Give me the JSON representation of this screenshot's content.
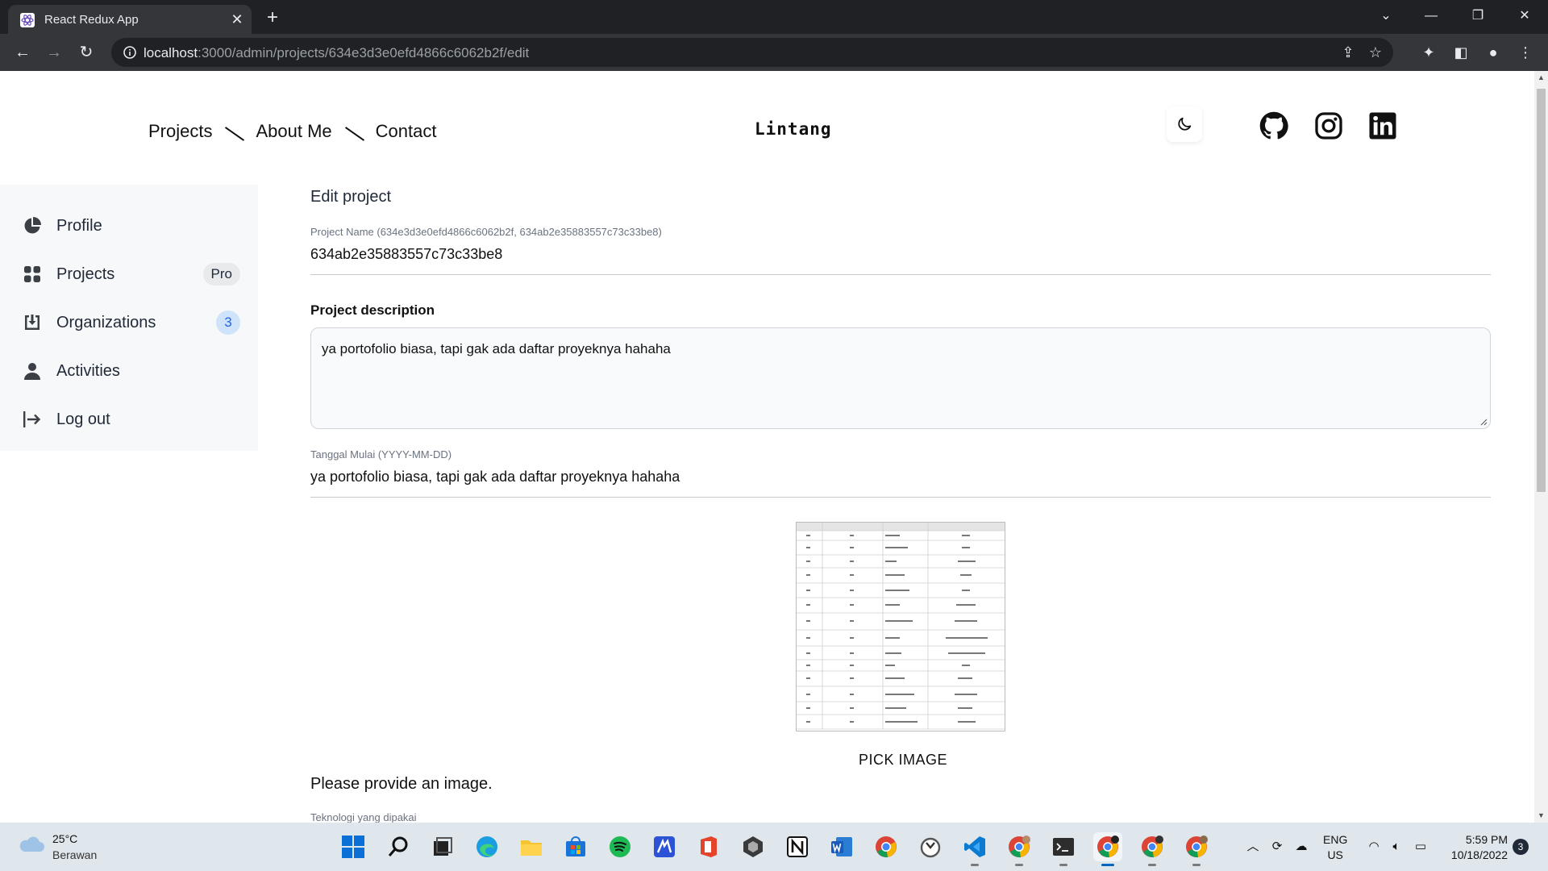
{
  "browser": {
    "tab_title": "React Redux App",
    "url_host": "localhost",
    "url_rest": ":3000/admin/projects/634e3d3e0efd4866c6062b2f/edit"
  },
  "header": {
    "nav": [
      "Projects",
      "About Me",
      "Contact"
    ],
    "brand": "Lintang",
    "icons": [
      "moon-icon",
      "github-icon",
      "instagram-icon",
      "linkedin-icon"
    ]
  },
  "sidebar": {
    "items": [
      {
        "label": "Profile",
        "icon": "pie-chart-icon"
      },
      {
        "label": "Projects",
        "icon": "grid-icon",
        "badge": "Pro"
      },
      {
        "label": "Organizations",
        "icon": "download-box-icon",
        "badge": "3"
      },
      {
        "label": "Activities",
        "icon": "person-icon"
      },
      {
        "label": "Log out",
        "icon": "logout-icon"
      }
    ]
  },
  "form": {
    "title": "Edit project",
    "name_label": "Project Name (634e3d3e0efd4866c6062b2f, 634ab2e35883557c73c33be8)",
    "name_value": "634ab2e35883557c73c33be8",
    "desc_label": "Project description",
    "desc_value": "ya portofolio biasa, tapi gak ada daftar proyeknya hahaha",
    "date_label": "Tanggal Mulai (YYYY-MM-DD)",
    "date_value": "ya portofolio biasa, tapi gak ada daftar proyeknya hahaha",
    "pick_image": "PICK IMAGE",
    "provide_image": "Please provide an image.",
    "tech_label": "Teknologi yang dipakai"
  },
  "taskbar": {
    "weather_temp": "25°C",
    "weather_desc": "Berawan",
    "lang_1": "ENG",
    "lang_2": "US",
    "time": "5:59 PM",
    "date": "10/18/2022",
    "notifications": "3"
  },
  "colors": {
    "accent": "#2563eb",
    "sidebar_bg": "#f7f8f9",
    "chrome_dark": "#202124"
  }
}
